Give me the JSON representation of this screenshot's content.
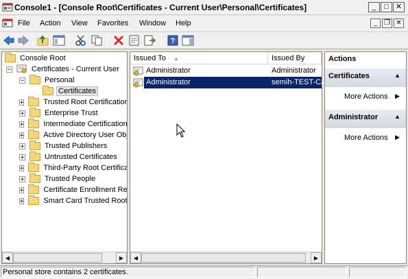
{
  "window": {
    "title": "Console1 - [Console Root\\Certificates - Current User\\Personal\\Certificates]",
    "minimize_glyph": "_",
    "maximize_glyph": "□",
    "close_glyph": "✕"
  },
  "menu": {
    "items": [
      "File",
      "Action",
      "View",
      "Favorites",
      "Window",
      "Help"
    ],
    "mdi_minimize": "_",
    "mdi_restore": "❐",
    "mdi_close": "✕"
  },
  "toolbar": {
    "icons": [
      "back-arrow-icon",
      "forward-arrow-icon",
      "up-folder-icon",
      "show-hide-tree-icon",
      "cut-icon",
      "copy-icon",
      "delete-icon",
      "properties-icon",
      "export-list-icon",
      "help-icon",
      "show-hide-action-pane-icon"
    ]
  },
  "tree": {
    "items": [
      {
        "label": "Console Root",
        "indent": 0,
        "expander": "",
        "icon": "folder"
      },
      {
        "label": "Certificates - Current User",
        "indent": 1,
        "expander": "−",
        "icon": "cert-store"
      },
      {
        "label": "Personal",
        "indent": 2,
        "expander": "−",
        "icon": "folder"
      },
      {
        "label": "Certificates",
        "indent": 3,
        "expander": "",
        "icon": "folder",
        "selected": true
      },
      {
        "label": "Trusted Root Certification",
        "indent": 2,
        "expander": "+",
        "icon": "folder"
      },
      {
        "label": "Enterprise Trust",
        "indent": 2,
        "expander": "+",
        "icon": "folder"
      },
      {
        "label": "Intermediate Certification",
        "indent": 2,
        "expander": "+",
        "icon": "folder"
      },
      {
        "label": "Active Directory User Obj",
        "indent": 2,
        "expander": "+",
        "icon": "folder"
      },
      {
        "label": "Trusted Publishers",
        "indent": 2,
        "expander": "+",
        "icon": "folder"
      },
      {
        "label": "Untrusted Certificates",
        "indent": 2,
        "expander": "+",
        "icon": "folder"
      },
      {
        "label": "Third-Party Root Certifica",
        "indent": 2,
        "expander": "+",
        "icon": "folder"
      },
      {
        "label": "Trusted People",
        "indent": 2,
        "expander": "+",
        "icon": "folder"
      },
      {
        "label": "Certificate Enrollment Re",
        "indent": 2,
        "expander": "+",
        "icon": "folder"
      },
      {
        "label": "Smart Card Trusted Root",
        "indent": 2,
        "expander": "+",
        "icon": "folder"
      }
    ]
  },
  "list": {
    "columns": [
      {
        "label": "Issued To",
        "sort_glyph": "▲"
      },
      {
        "label": "Issued By",
        "sort_glyph": ""
      }
    ],
    "rows": [
      {
        "issued_to": "Administrator",
        "issued_by": "Administrator",
        "selected": false
      },
      {
        "issued_to": "Administrator",
        "issued_by": "semih-TEST-CA",
        "selected": true
      }
    ]
  },
  "actions": {
    "header": "Actions",
    "sections": [
      {
        "title": "Certificates",
        "items": [
          "More Actions"
        ]
      },
      {
        "title": "Administrator",
        "items": [
          "More Actions"
        ]
      }
    ]
  },
  "statusbar": {
    "text": "Personal store contains 2 certificates."
  },
  "colors": {
    "selection": "#0a246a",
    "title_text": "#000000",
    "pane_border": "#828790"
  }
}
